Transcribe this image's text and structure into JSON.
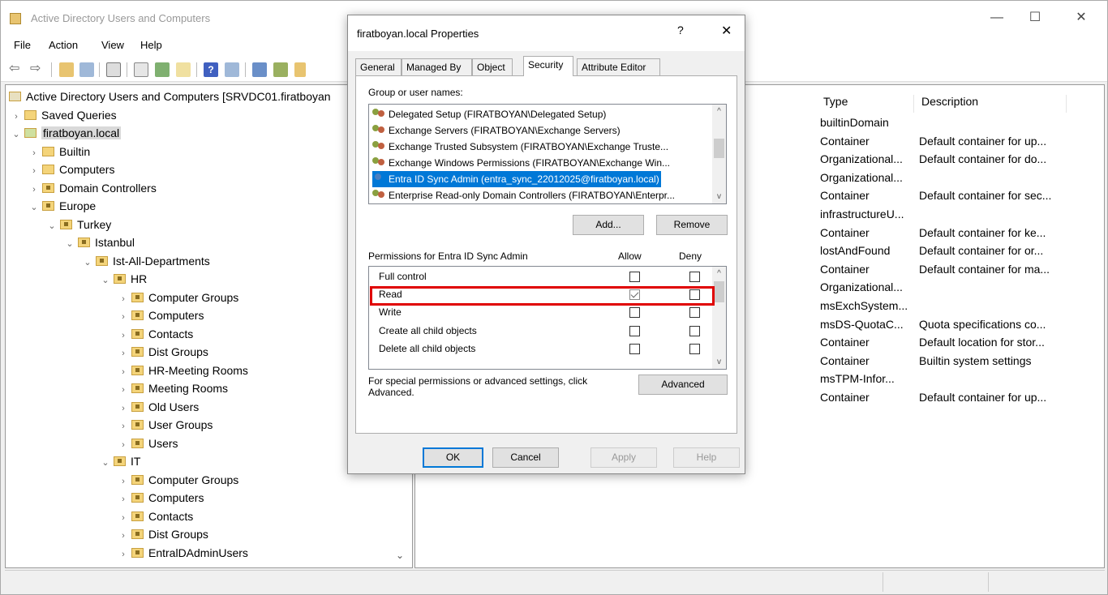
{
  "window": {
    "title": "Active Directory Users and Computers",
    "controls": {
      "minimize": "—",
      "maximize": "☐",
      "close": "✕"
    }
  },
  "menu": [
    "File",
    "Action",
    "View",
    "Help"
  ],
  "tree": {
    "root": "Active Directory Users and Computers [SRVDC01.firatboyan",
    "items": [
      "Saved Queries",
      "firatboyan.local",
      "Builtin",
      "Computers",
      "Domain Controllers",
      "Europe",
      "Turkey",
      "Istanbul",
      "Ist-All-Departments",
      "HR",
      "Computer Groups",
      "Computers",
      "Contacts",
      "Dist Groups",
      "HR-Meeting Rooms",
      "Meeting Rooms",
      "Old Users",
      "User Groups",
      "Users",
      "IT",
      "Computer Groups",
      "Computers",
      "Contacts",
      "Dist Groups",
      "EntralDAdminUsers"
    ]
  },
  "list": {
    "columns": [
      "Type",
      "Description"
    ],
    "rows": [
      [
        "builtinDomain",
        ""
      ],
      [
        "Container",
        "Default container for up..."
      ],
      [
        "Organizational...",
        "Default container for do..."
      ],
      [
        "Organizational...",
        ""
      ],
      [
        "Container",
        "Default container for sec..."
      ],
      [
        "infrastructureU...",
        ""
      ],
      [
        "Container",
        "Default container for ke..."
      ],
      [
        "lostAndFound",
        "Default container for or..."
      ],
      [
        "Container",
        "Default container for ma..."
      ],
      [
        "Organizational...",
        ""
      ],
      [
        "msExchSystem...",
        ""
      ],
      [
        "msDS-QuotaC...",
        "Quota specifications co..."
      ],
      [
        "Container",
        "Default location for stor..."
      ],
      [
        "Container",
        "Builtin system settings"
      ],
      [
        "msTPM-Infor...",
        ""
      ],
      [
        "Container",
        "Default container for up..."
      ]
    ]
  },
  "dialog": {
    "title": "firatboyan.local Properties",
    "help": "?",
    "close": "✕",
    "tabs": [
      "General",
      "Managed By",
      "Object",
      "Security",
      "Attribute Editor"
    ],
    "group_label": "Group or user names:",
    "names": [
      "Delegated Setup (FIRATBOYAN\\Delegated Setup)",
      "Exchange Servers (FIRATBOYAN\\Exchange Servers)",
      "Exchange Trusted Subsystem (FIRATBOYAN\\Exchange Truste...",
      "Exchange Windows Permissions (FIRATBOYAN\\Exchange Win...",
      "Entra ID Sync Admin (entra_sync_22012025@firatboyan.local)",
      "Enterprise Read-only Domain Controllers (FIRATBOYAN\\Enterpr..."
    ],
    "add_button": "Add...",
    "remove_button": "Remove",
    "perm_label": "Permissions for Entra ID Sync Admin",
    "allow": "Allow",
    "deny": "Deny",
    "permissions": [
      {
        "name": "Full control",
        "allow": false,
        "deny": false
      },
      {
        "name": "Read",
        "allow": true,
        "deny": false
      },
      {
        "name": "Write",
        "allow": false,
        "deny": false
      },
      {
        "name": "Create all child objects",
        "allow": false,
        "deny": false
      },
      {
        "name": "Delete all child objects",
        "allow": false,
        "deny": false
      }
    ],
    "advanced_text": "For special permissions or advanced settings, click Advanced.",
    "advanced_button": "Advanced",
    "ok": "OK",
    "cancel": "Cancel",
    "apply": "Apply",
    "help_button": "Help"
  },
  "colors": {
    "selection": "#0078d7",
    "highlight": "#e00000"
  }
}
